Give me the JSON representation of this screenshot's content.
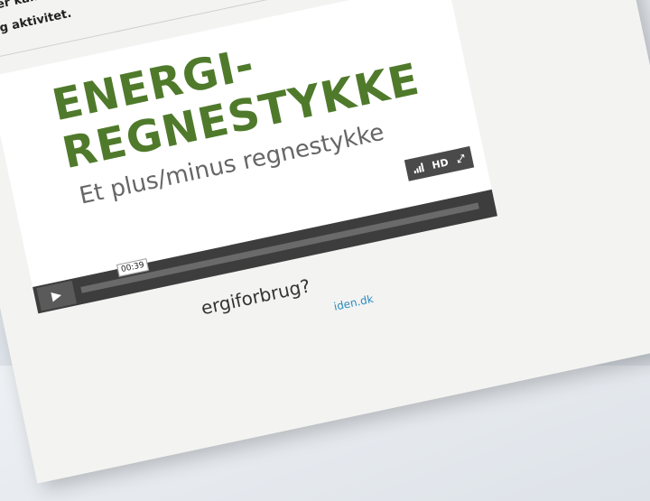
{
  "intro": {
    "line1": "Her kan du se en video, der for",
    "line2": "og aktivitet."
  },
  "video": {
    "title_line1": "ENERGI-",
    "title_line2": "REGNESTYKKE",
    "subtitle": "Et plus/minus regnestykke",
    "hd_label": "HD",
    "time": "00:39",
    "progress": 0.0
  },
  "below": {
    "heading": "ergiforbrug?",
    "link": "iden.dk"
  },
  "colors": {
    "title_green": "#4f7a2b",
    "link_blue": "#2a8bbf",
    "arrow_teal": "#33aacc"
  },
  "icons": {
    "arrow": "arrow-right-icon",
    "signal": "signal-bars-icon",
    "fullscreen": "fullscreen-icon",
    "play": "play-icon"
  }
}
